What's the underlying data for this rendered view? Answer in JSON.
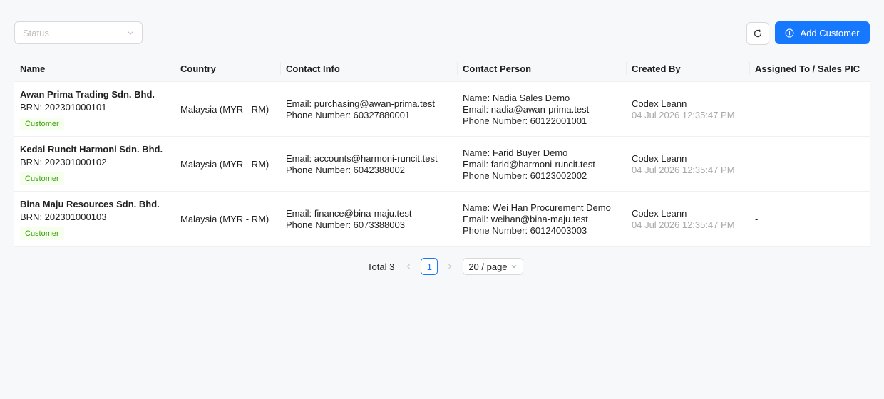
{
  "toolbar": {
    "status_placeholder": "Status",
    "add_label": "Add Customer"
  },
  "table": {
    "columns": [
      "Name",
      "Country",
      "Contact Info",
      "Contact Person",
      "Created By",
      "Assigned To / Sales PIC"
    ],
    "rows": [
      {
        "name": "Awan Prima Trading Sdn. Bhd.",
        "brn": "BRN: 202301000101",
        "tag": "Customer",
        "country": "Malaysia (MYR - RM)",
        "contact_email": "Email: purchasing@awan-prima.test",
        "contact_phone": "Phone Number: 60327880001",
        "person_name": "Name: Nadia Sales Demo",
        "person_email": "Email: nadia@awan-prima.test",
        "person_phone": "Phone Number: 60122001001",
        "created_by": "Codex Leann",
        "created_at": "04 Jul 2026 12:35:47 PM",
        "assigned": "-"
      },
      {
        "name": "Kedai Runcit Harmoni Sdn. Bhd.",
        "brn": "BRN: 202301000102",
        "tag": "Customer",
        "country": "Malaysia (MYR - RM)",
        "contact_email": "Email: accounts@harmoni-runcit.test",
        "contact_phone": "Phone Number: 6042388002",
        "person_name": "Name: Farid Buyer Demo",
        "person_email": "Email: farid@harmoni-runcit.test",
        "person_phone": "Phone Number: 60123002002",
        "created_by": "Codex Leann",
        "created_at": "04 Jul 2026 12:35:47 PM",
        "assigned": "-"
      },
      {
        "name": "Bina Maju Resources Sdn. Bhd.",
        "brn": "BRN: 202301000103",
        "tag": "Customer",
        "country": "Malaysia (MYR - RM)",
        "contact_email": "Email: finance@bina-maju.test",
        "contact_phone": "Phone Number: 6073388003",
        "person_name": "Name: Wei Han Procurement Demo",
        "person_email": "Email: weihan@bina-maju.test",
        "person_phone": "Phone Number: 60124003003",
        "created_by": "Codex Leann",
        "created_at": "04 Jul 2026 12:35:47 PM",
        "assigned": "-"
      }
    ]
  },
  "pagination": {
    "total": "Total 3",
    "current_page": "1",
    "page_size": "20 / page"
  },
  "colors": {
    "primary": "#1677ff",
    "tag_text": "#389e0d",
    "tag_bg": "#f6ffed",
    "background": "#f7f8fa"
  }
}
